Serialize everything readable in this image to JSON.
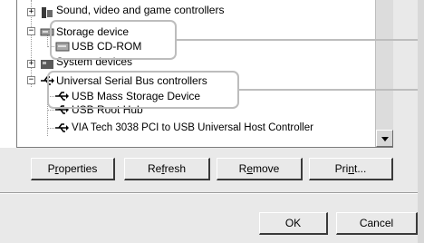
{
  "tree": {
    "items": [
      {
        "label": "Sound, video and game controllers",
        "expander": "+",
        "icon": "speaker-icon"
      },
      {
        "label": "Storage device",
        "expander": "−",
        "icon": "drive-icon"
      },
      {
        "label": "USB CD-ROM",
        "icon": "cdrom-drive-icon"
      },
      {
        "label": "System devices",
        "expander": "+",
        "icon": "computer-board-icon"
      },
      {
        "label": "Universal Serial Bus controllers",
        "expander": "−",
        "icon": "usb-icon"
      },
      {
        "label": "USB Mass Storage Device",
        "icon": "usb-icon"
      },
      {
        "label": "USB Root Hub",
        "icon": "usb-icon"
      },
      {
        "label": "VIA Tech 3038 PCI to USB Universal Host Controller",
        "icon": "usb-icon"
      }
    ]
  },
  "buttons": {
    "properties": {
      "pre": "P",
      "acc": "r",
      "post": "operties"
    },
    "refresh": {
      "pre": "Re",
      "acc": "f",
      "post": "resh"
    },
    "remove": {
      "pre": "R",
      "acc": "e",
      "post": "move"
    },
    "print": {
      "pre": "Pri",
      "acc": "n",
      "post": "t..."
    },
    "ok": "OK",
    "cancel": "Cancel"
  },
  "colors": {
    "dialog_bg": "#e9e9e9",
    "tree_bg": "#ffffff",
    "callout": "#bdbdbd"
  }
}
